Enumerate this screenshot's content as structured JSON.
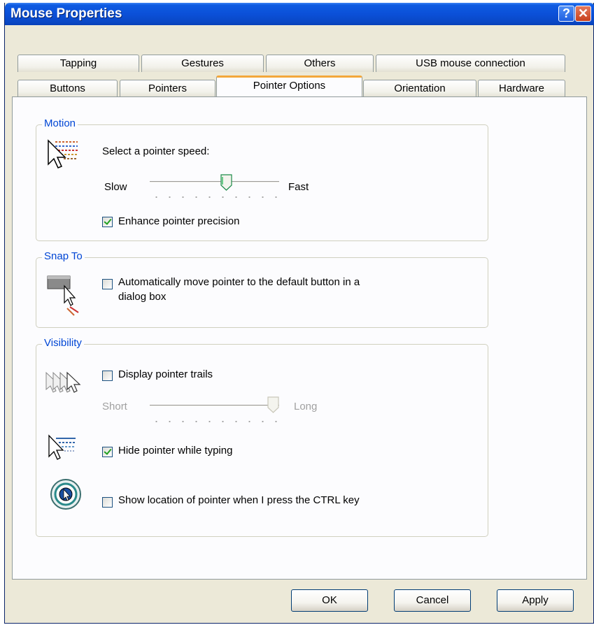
{
  "window": {
    "title": "Mouse Properties"
  },
  "titlebar": {
    "help_glyph": "?",
    "close_glyph": "✕"
  },
  "tabs_back": [
    "Tapping",
    "Gestures",
    "Others",
    "USB mouse connection"
  ],
  "tabs_front": [
    "Buttons",
    "Pointers",
    "Pointer Options",
    "Orientation",
    "Hardware"
  ],
  "active_tab": "Pointer Options",
  "motion": {
    "title": "Motion",
    "speed_label": "Select a pointer speed:",
    "slow_label": "Slow",
    "fast_label": "Fast",
    "speed_value": 6,
    "speed_max": 10,
    "enhance_label": "Enhance pointer precision",
    "enhance_checked": true
  },
  "snap": {
    "title": "Snap To",
    "auto_label_line1": "Automatically move pointer to the default button in a",
    "auto_label_line2": "dialog box",
    "auto_checked": false
  },
  "visibility": {
    "title": "Visibility",
    "trails_label": "Display pointer trails",
    "trails_checked": false,
    "short_label": "Short",
    "long_label": "Long",
    "trails_value": 6,
    "trails_max": 6,
    "hide_label": "Hide pointer while typing",
    "hide_checked": true,
    "ctrl_label": "Show location of pointer when I press the CTRL key",
    "ctrl_checked": false
  },
  "buttons": {
    "ok": "OK",
    "cancel": "Cancel",
    "apply": "Apply"
  },
  "colors": {
    "group_title": "#0046d5",
    "active_tab_accent": "#f3a73a",
    "titlebar": "#0b50d8"
  }
}
